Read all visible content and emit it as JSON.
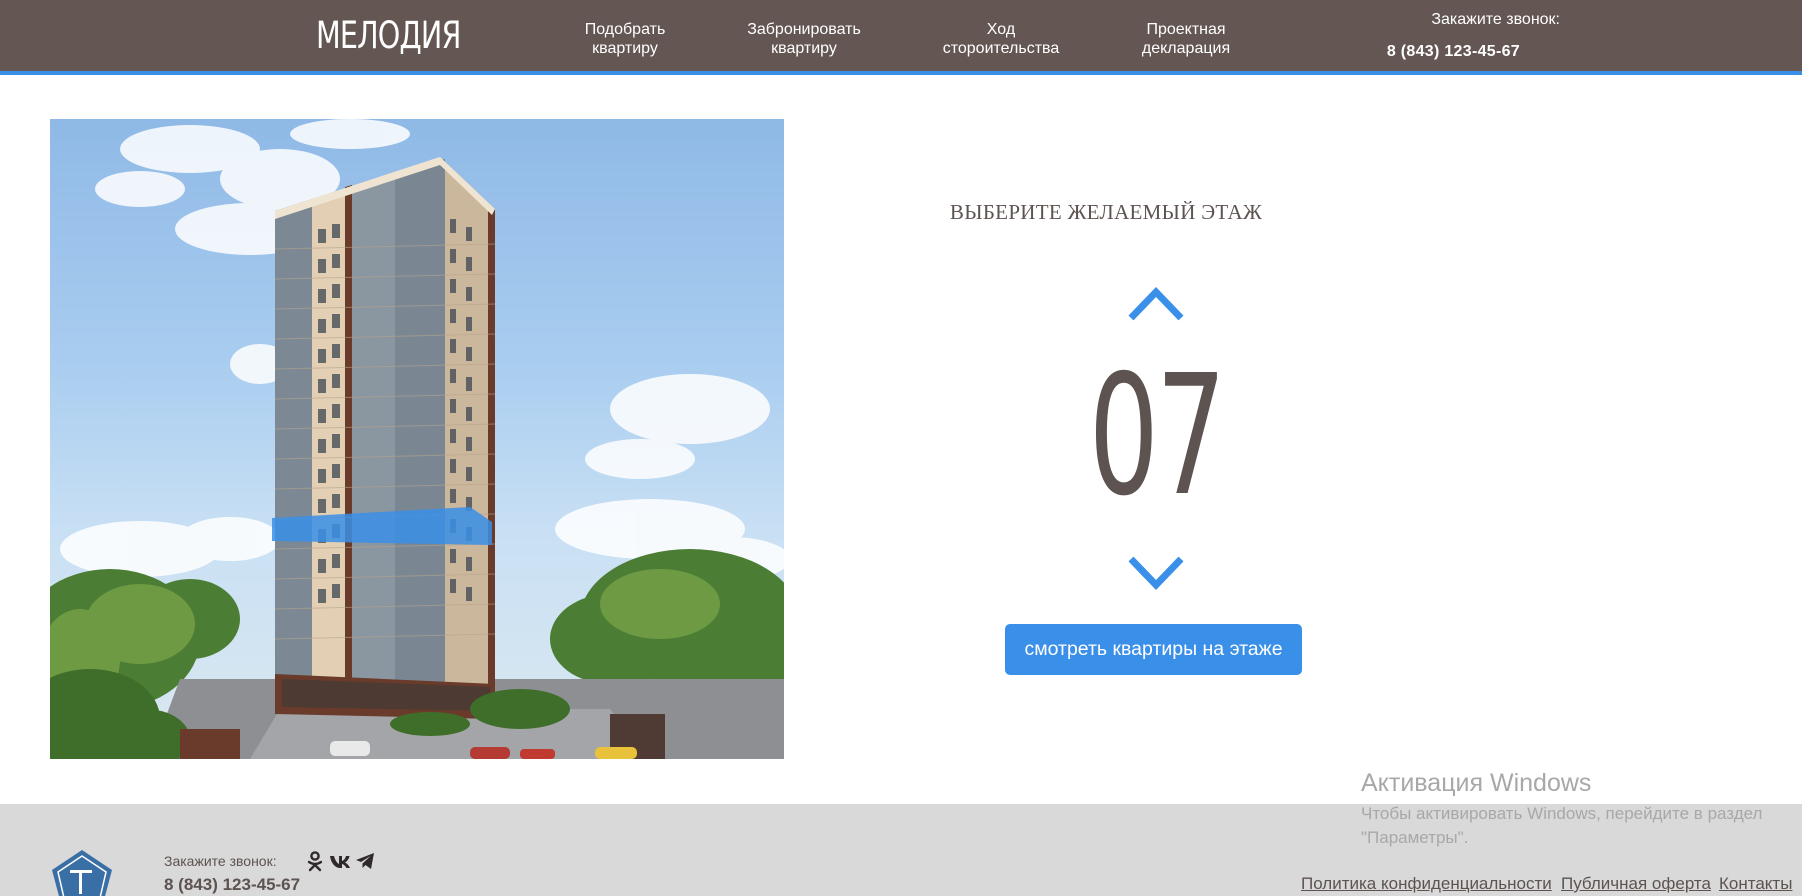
{
  "header": {
    "logo": "МЕЛОДИЯ",
    "nav": [
      {
        "label": "Подобрать\nквартиру"
      },
      {
        "label": "Забронировать\nквартиру"
      },
      {
        "label": "Ход\nстороительства"
      },
      {
        "label": "Проектная\nдекларация"
      }
    ],
    "call_label": "Закажите звонок:",
    "phone": "8 (843) 123-45-67"
  },
  "selector": {
    "title": "ВЫБЕРИТЕ ЖЕЛАЕМЫЙ ЭТАЖ",
    "floor": "07",
    "view_button": "смотреть квартиры на этаже",
    "accent": "#3a8fe8"
  },
  "watermark": {
    "title": "Активация Windows",
    "text": "Чтобы активировать Windows, перейдите в раздел \"Параметры\"."
  },
  "footer": {
    "call_label": "Закажите звонок:",
    "phone": "8 (843) 123-45-67",
    "social": [
      "odnoklassniki-icon",
      "vk-icon",
      "telegram-icon"
    ],
    "links": [
      "Политика конфиденциальности",
      "Публичная оферта",
      "Контакты"
    ]
  },
  "colors": {
    "header_bg": "#645753",
    "accent": "#3a8fe8",
    "text": "#5d5350",
    "footer_bg": "#d9d9d9"
  }
}
